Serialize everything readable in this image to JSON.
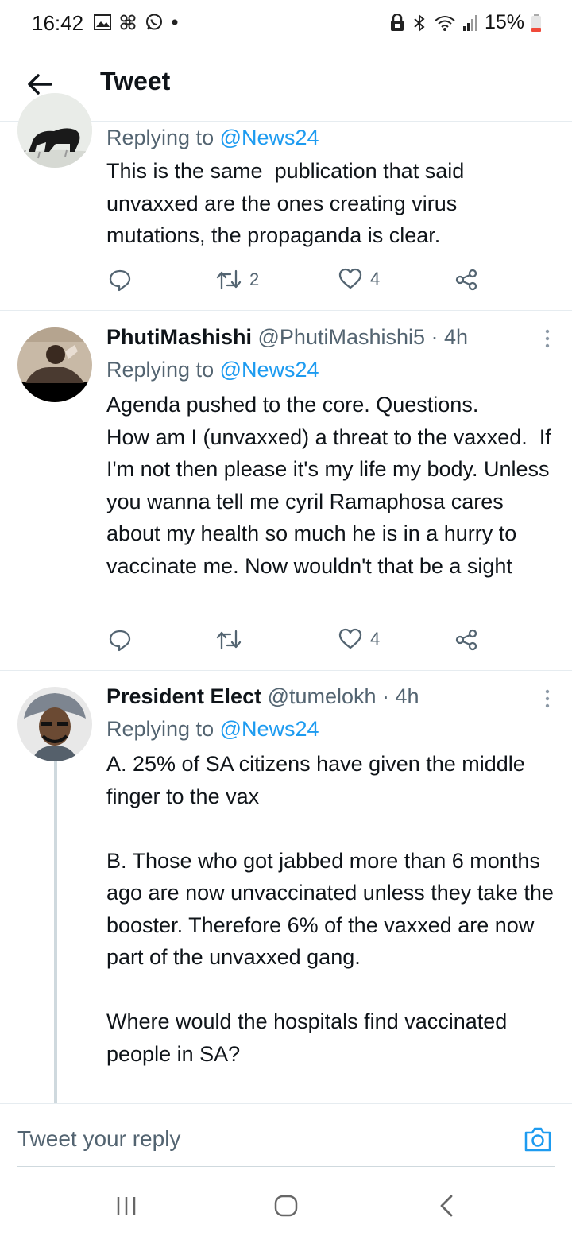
{
  "status_bar": {
    "time": "16:42",
    "battery": "15%",
    "icons": [
      "gallery-icon",
      "fan-icon",
      "whatsapp-icon",
      "dot-icon",
      "lock-icon",
      "bluetooth-icon",
      "wifi-icon",
      "signal-icon",
      "battery-icon"
    ]
  },
  "header": {
    "title": "Tweet"
  },
  "tweets": [
    {
      "replying_prefix": "Replying to ",
      "replying_to": "@News24",
      "text": "This is the same  publication that said unvaxxed are the ones creating virus mutations, the propaganda is clear.",
      "retweets": "2",
      "likes": "4"
    },
    {
      "name": "PhutiMashishi",
      "handle_time": " @PhutiMashishi5 · 4h",
      "replying_prefix": "Replying to ",
      "replying_to": "@News24",
      "text": "Agenda pushed to the core. Questions.\nHow am I (unvaxxed) a threat to the vaxxed.  If I'm not then please it's my life my body. Unless you wanna tell me cyril Ramaphosa cares about my health so much he is in a hurry to vaccinate me. Now wouldn't that be a sight",
      "retweets": "",
      "likes": "4"
    },
    {
      "name": "President Elect",
      "handle_time": " @tumelokh · 4h",
      "replying_prefix": "Replying to ",
      "replying_to": "@News24",
      "text": "A. 25% of SA citizens have given the middle finger to the vax\n\nB. Those who got jabbed more than 6 months ago are now unvaccinated unless they take the booster. Therefore 6% of the vaxxed are now part of the unvaxxed gang.\n\nWhere would the hospitals find vaccinated people in SA?"
    }
  ],
  "composer": {
    "placeholder": "Tweet your reply"
  },
  "colors": {
    "accent": "#1d9bf0",
    "text": "#0f1419",
    "secondary": "#536471"
  }
}
